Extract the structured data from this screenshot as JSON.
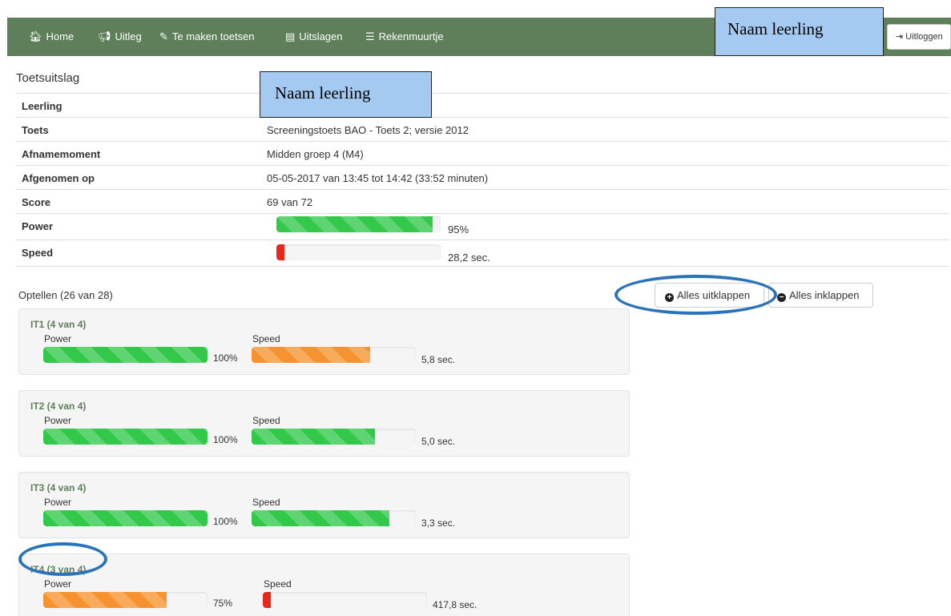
{
  "navbar": {
    "items": [
      {
        "icon": "home-icon",
        "label": "Home"
      },
      {
        "icon": "bullhorn-icon",
        "label": "Uitleg"
      },
      {
        "icon": "pencil-icon",
        "label": "Te maken toetsen"
      },
      {
        "icon": "book-icon",
        "label": "Uitslagen"
      },
      {
        "icon": "list-icon",
        "label": "Rekenmuurtje"
      }
    ],
    "logout_label": "Uitloggen",
    "student_name_overlay": "Naam leerling"
  },
  "result": {
    "title": "Toetsuitslag",
    "rows": [
      {
        "label": "Leerling",
        "value": "Naam leerling"
      },
      {
        "label": "Toets",
        "value": "Screeningstoets BAO - Toets 2; versie 2012"
      },
      {
        "label": "Afnamemoment",
        "value": "Midden groep 4 (M4)"
      },
      {
        "label": "Afgenomen op",
        "value": "05-05-2017 van 13:45 tot 14:42 (33:52 minuten)"
      },
      {
        "label": "Score",
        "value": "69 van 72"
      }
    ],
    "power": {
      "label": "Power",
      "value_text": "95%",
      "fraction": 0.95
    },
    "speed": {
      "label": "Speed",
      "value_text": "28,2 sec.",
      "fraction": 0.05
    }
  },
  "category": {
    "title": "Optellen (26 van 28)",
    "expand_all_label": "Alles uitklappen",
    "collapse_all_label": "Alles inklappen"
  },
  "items": [
    {
      "title": "IT1 (4 van 4)",
      "power_label": "Power",
      "speed_label": "Speed",
      "power_text": "100%",
      "power_fraction": 1.0,
      "power_color": "green",
      "speed_text": "5,8 sec.",
      "speed_fraction": 0.72,
      "speed_color": "orange"
    },
    {
      "title": "IT2 (4 van 4)",
      "power_label": "Power",
      "speed_label": "Speed",
      "power_text": "100%",
      "power_fraction": 1.0,
      "power_color": "green",
      "speed_text": "5,0 sec.",
      "speed_fraction": 0.75,
      "speed_color": "green"
    },
    {
      "title": "IT3 (4 van 4)",
      "power_label": "Power",
      "speed_label": "Speed",
      "power_text": "100%",
      "power_fraction": 1.0,
      "power_color": "green",
      "speed_text": "3,3 sec.",
      "speed_fraction": 0.84,
      "speed_color": "green"
    },
    {
      "title": "IT4 (3 van 4)",
      "power_label": "Power",
      "speed_label": "Speed",
      "power_text": "75%",
      "power_fraction": 0.75,
      "power_color": "orange",
      "speed_text": "417,8 sec.",
      "speed_fraction": 0.05,
      "speed_color": "red"
    }
  ],
  "colors": {
    "navbar": "#5f7f5a",
    "green": "#32c84a",
    "orange": "#f7932e",
    "red": "#e8261b",
    "highlight": "#2b73b8",
    "overlay_box": "#a5caf2"
  }
}
